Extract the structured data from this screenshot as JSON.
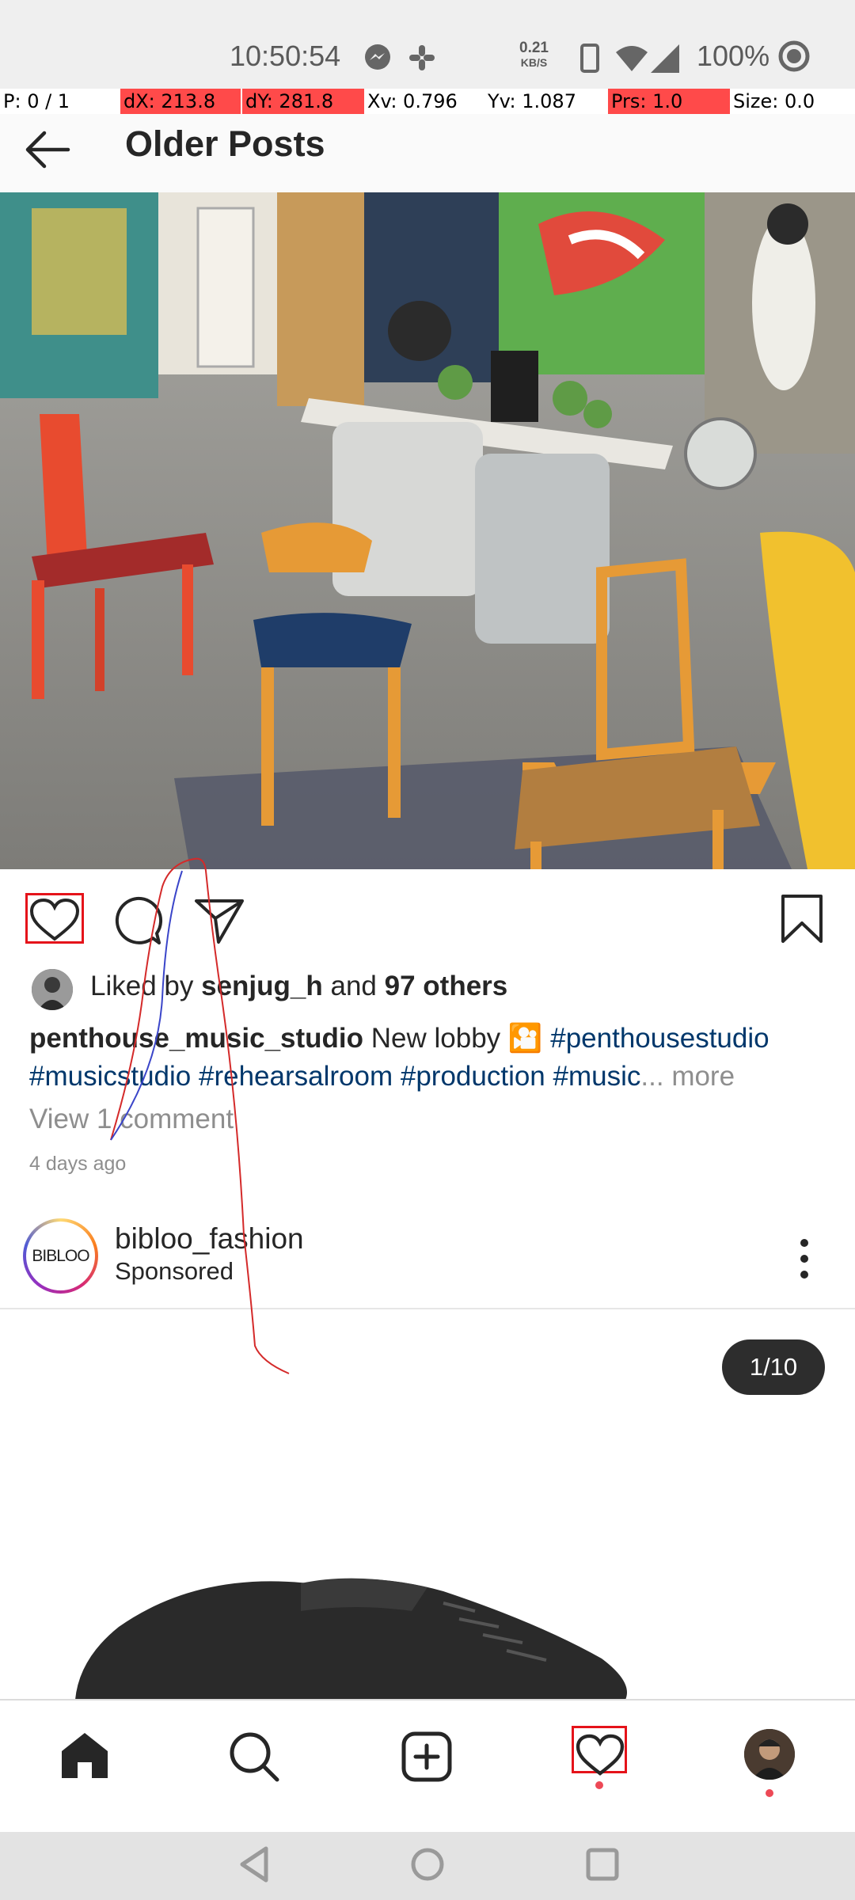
{
  "status_bar": {
    "time": "10:50:54",
    "net_speed_value": "0.21",
    "net_speed_unit": "KB/S",
    "battery": "100%",
    "icons": [
      "messenger-icon",
      "slack-icon",
      "phone-icon",
      "wifi-icon",
      "signal-icon",
      "target-icon"
    ]
  },
  "pointer_overlay": {
    "p": "P: 0 / 1",
    "dx": "dX: 213.8",
    "dy": "dY: 281.8",
    "xv": "Xv: 0.796",
    "yv": "Yv: 1.087",
    "prs": "Prs: 1.0",
    "size": "Size: 0.0",
    "highlight_color": "#ff4a4a"
  },
  "app_bar": {
    "title": "Older Posts",
    "back_icon": "arrow-left-icon"
  },
  "post": {
    "actions": [
      "heart-icon",
      "comment-icon",
      "share-icon",
      "bookmark-icon"
    ],
    "liked_by_prefix": "Liked by",
    "liked_by_user": "senjug_h",
    "liked_by_and": "and",
    "liked_by_others": "97 others",
    "caption_user": "penthouse_music_studio",
    "caption_text": "New lobby",
    "caption_emoji": "🎦",
    "hashtags": [
      "#penthousestudio",
      "#musicstudio",
      "#rehearsalroom",
      "#production",
      "#music"
    ],
    "ellipsis": "...",
    "more": "more",
    "view_comments": "View 1 comment",
    "time_ago": "4 days ago"
  },
  "sponsored_post": {
    "avatar_text": "BIBLOO",
    "username": "bibloo_fashion",
    "label": "Sponsored",
    "menu_icon": "more-vertical-icon",
    "counter": "1/10"
  },
  "bottom_nav": {
    "items": [
      "home-icon",
      "search-icon",
      "add-post-icon",
      "activity-heart-icon",
      "profile-avatar"
    ],
    "active_highlight": "#e5131a",
    "notification_dot_color": "#ed4956"
  },
  "system_nav": [
    "back-triangle-icon",
    "home-circle-icon",
    "recents-square-icon"
  ]
}
